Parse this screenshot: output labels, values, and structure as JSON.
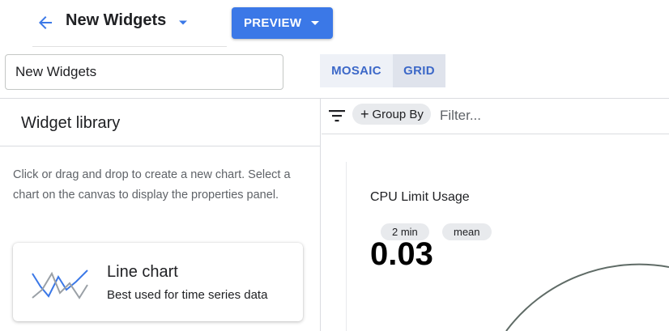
{
  "header": {
    "title": "New Widgets",
    "preview_label": "PREVIEW"
  },
  "name_field": {
    "value": "New Widgets"
  },
  "layout_toggle": {
    "options": [
      "MOSAIC",
      "GRID"
    ],
    "selected": "GRID"
  },
  "library": {
    "title": "Widget library",
    "help_text": "Click or drag and drop to create a new chart. Select a chart on the canvas to display the properties panel.",
    "cards": [
      {
        "title": "Line chart",
        "description": "Best used for time series data",
        "icon": "line-chart-icon"
      }
    ]
  },
  "filter_bar": {
    "groupby_label": "Group By",
    "filter_placeholder": "Filter..."
  },
  "widget": {
    "title": "CPU Limit Usage",
    "alignment_period": "2 min",
    "aggregation": "mean",
    "value": "0.03"
  },
  "colors": {
    "accent": "#3b78e7",
    "toggle_text": "#3c68c8",
    "gauge_arc": "#5f6b66"
  }
}
